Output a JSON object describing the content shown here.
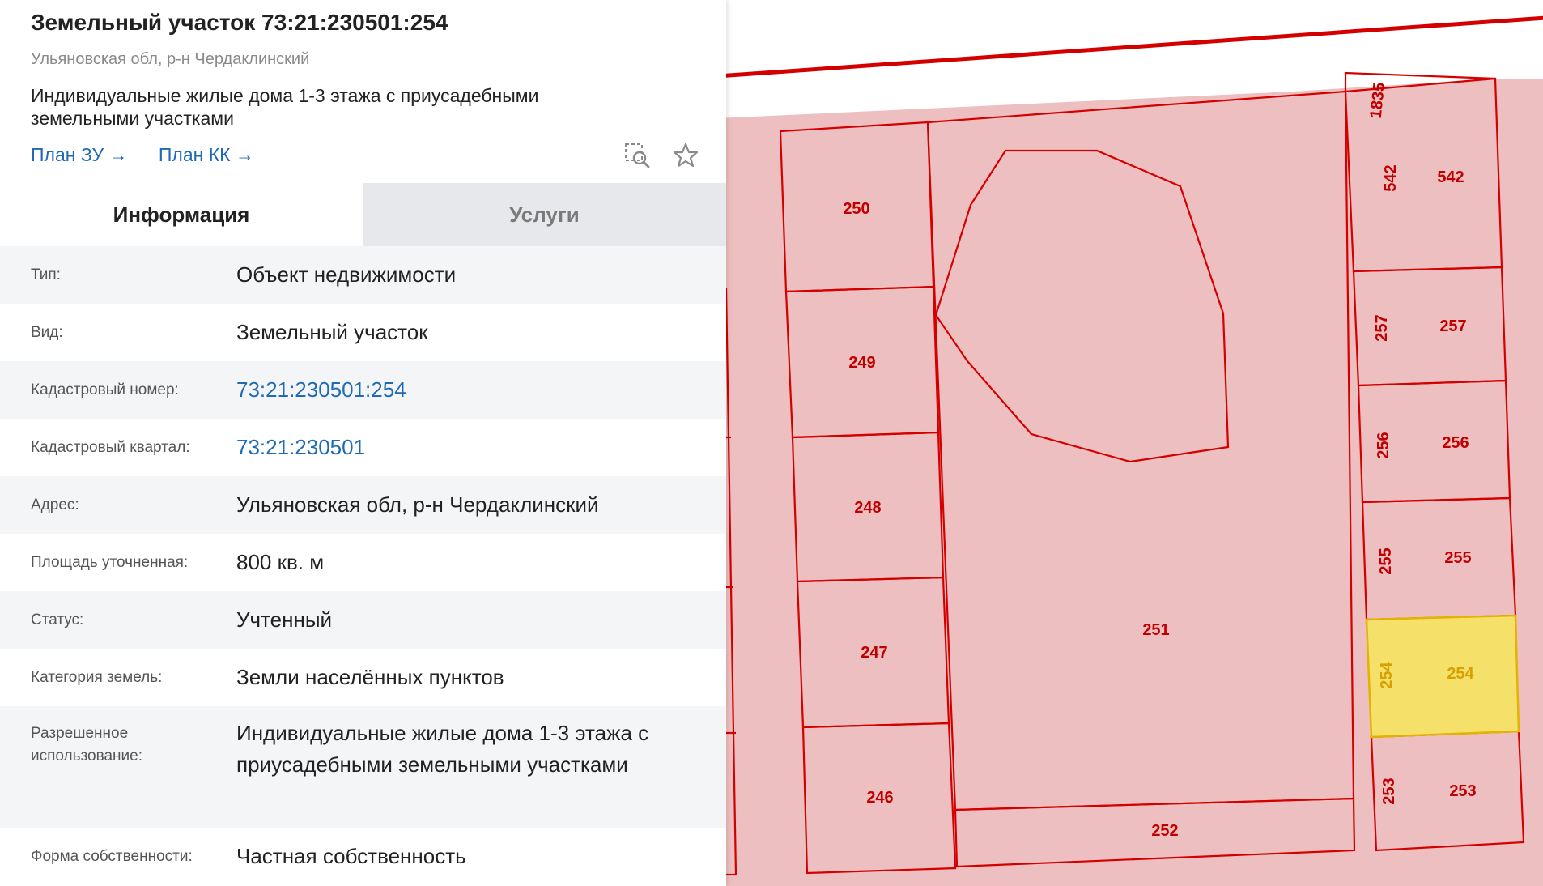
{
  "header": {
    "title": "Земельный участок 73:21:230501:254",
    "subtitle": "Ульяновская обл, р-н Чердаклинский",
    "description": "Индивидуальные жилые дома 1-3 этажа с приусадебными земельными участками",
    "link_plan_zu": "План ЗУ",
    "link_plan_kk": "План КК"
  },
  "tabs": {
    "info": "Информация",
    "services": "Услуги"
  },
  "info": {
    "type_label": "Тип:",
    "type_value": "Объект недвижимости",
    "kind_label": "Вид:",
    "kind_value": "Земельный участок",
    "cadastral_number_label": "Кадастровый номер:",
    "cadastral_number_value": "73:21:230501:254",
    "cadastral_quarter_label": "Кадастровый квартал:",
    "cadastral_quarter_value": "73:21:230501",
    "address_label": "Адрес:",
    "address_value": "Ульяновская обл, р-н Чердаклинский",
    "area_label": "Площадь уточненная:",
    "area_value": "800 кв. м",
    "status_label": "Статус:",
    "status_value": "Учтенный",
    "land_category_label": "Категория земель:",
    "land_category_value": "Земли населённых пунктов",
    "permitted_use_label": "Разрешенное использование:",
    "permitted_use_value": "Индивидуальные жилые дома 1-3 этажа с приусадебными земельными участками",
    "ownership_label": "Форма собственности:",
    "ownership_value": "Частная собственность"
  },
  "map": {
    "labels": {
      "p1835": "1835",
      "p542": "542",
      "p250": "250",
      "p257": "257",
      "p249": "249",
      "p256": "256",
      "p248": "248",
      "p255": "255",
      "p251": "251",
      "p254": "254",
      "p247": "247",
      "p253": "253",
      "p246": "246",
      "p252": "252"
    },
    "colors": {
      "parcel_fill": "#eebfc0",
      "parcel_stroke": "#d40000",
      "selected_fill": "#f5e06a",
      "selected_stroke": "#e2b300"
    }
  }
}
